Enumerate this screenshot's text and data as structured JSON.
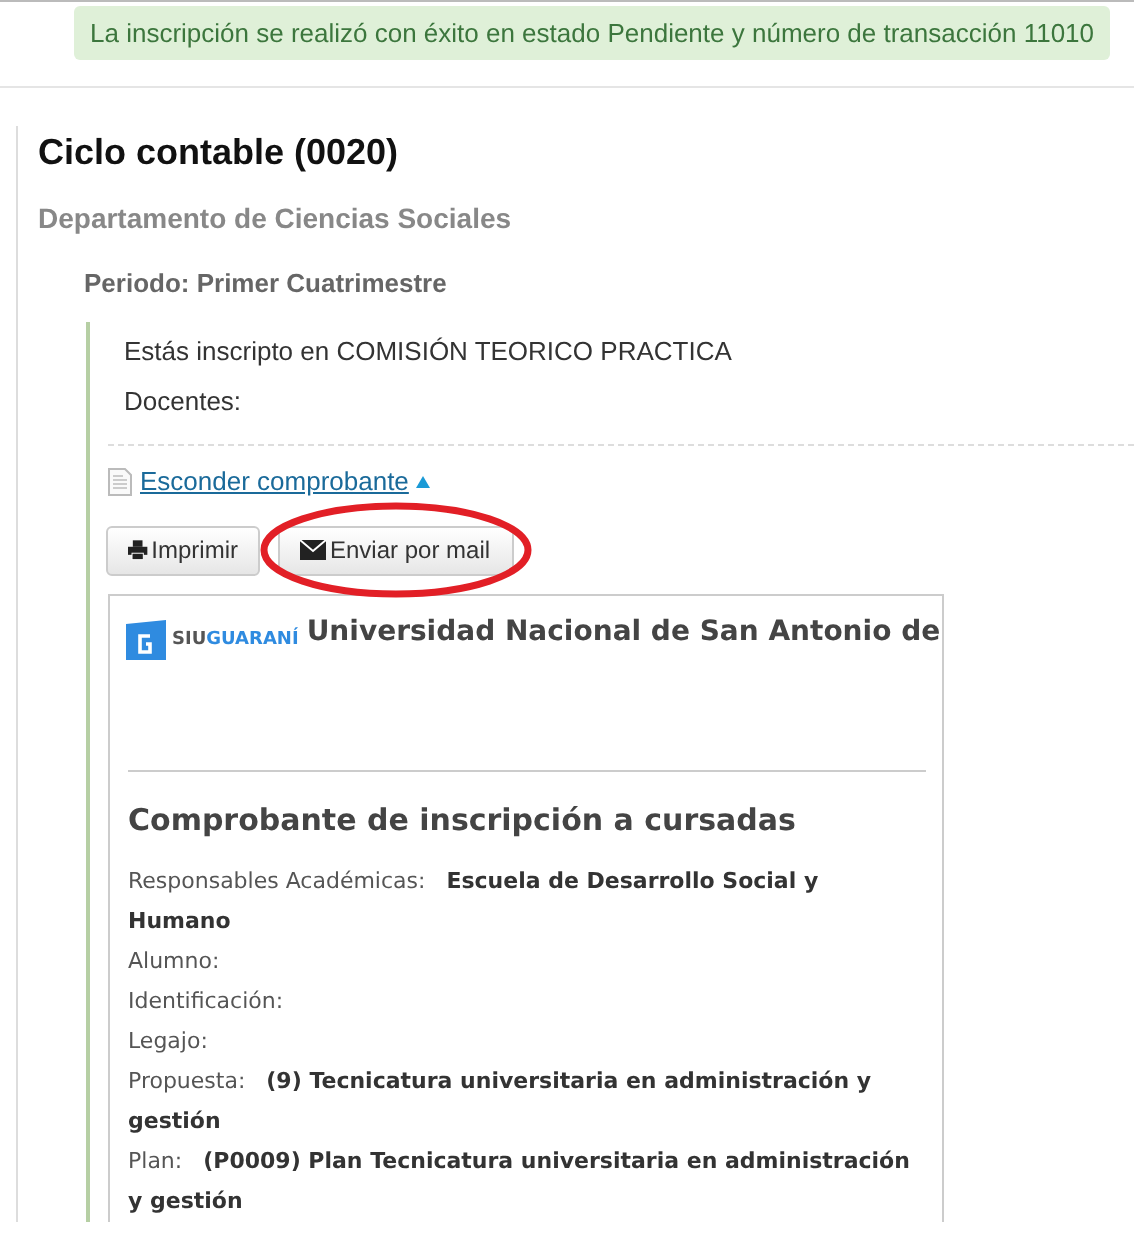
{
  "alert": {
    "text": "La inscripción se realizó con éxito en estado Pendiente y número de transacción 11010"
  },
  "course": {
    "title": "Ciclo contable (0020)",
    "department": "Departamento de Ciencias Sociales",
    "period": "Periodo: Primer Cuatrimestre"
  },
  "details": [
    "Estás inscripto en COMISIÓN TEORICO PRACTICA",
    "Docentes:"
  ],
  "toggle": {
    "label": "Esconder comprobante",
    "expanded": true
  },
  "buttons": [
    {
      "kind": "print",
      "label": "Imprimir",
      "circled": false
    },
    {
      "kind": "mail",
      "label": "Enviar por mail",
      "circled": true
    }
  ],
  "receipt": {
    "logo": {
      "prefix": "SIU",
      "suffix": "GUARANÍ"
    },
    "institution": "Universidad Nacional de San Antonio de",
    "heading": "Comprobante de inscripción a cursadas",
    "rows": [
      "Responsables Académicas:   **Escuela de Desarrollo Social y Humano**",
      "Alumno:",
      "Identificación:",
      "Legajo:",
      "Propuesta:   **(9) Tecnicatura universitaria en administración y gestión**",
      "Plan:   **(P0009) Plan Tecnicatura universitaria en administración y gestión**"
    ]
  }
}
